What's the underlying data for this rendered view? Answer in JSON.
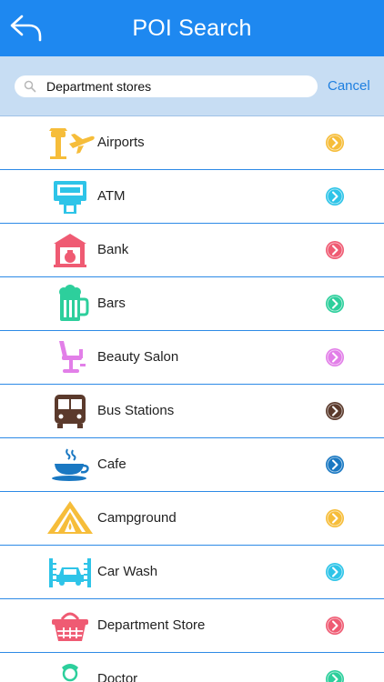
{
  "header": {
    "title": "POI Search"
  },
  "search": {
    "value": "Department stores",
    "cancel_label": "Cancel"
  },
  "items": [
    {
      "label": "Airports",
      "accent": "#f6bd3a",
      "icon": "airport-icon"
    },
    {
      "label": "ATM",
      "accent": "#2ec4e8",
      "icon": "atm-icon"
    },
    {
      "label": "Bank",
      "accent": "#ef5b73",
      "icon": "bank-icon"
    },
    {
      "label": "Bars",
      "accent": "#2dcf9c",
      "icon": "beer-icon"
    },
    {
      "label": "Beauty Salon",
      "accent": "#e27fe8",
      "icon": "salon-chair-icon"
    },
    {
      "label": "Bus Stations",
      "accent": "#5b3a2c",
      "icon": "bus-icon"
    },
    {
      "label": "Cafe",
      "accent": "#1a78c2",
      "icon": "coffee-cup-icon"
    },
    {
      "label": "Campground",
      "accent": "#f6bd3a",
      "icon": "tent-icon"
    },
    {
      "label": "Car Wash",
      "accent": "#2ec4e8",
      "icon": "car-wash-icon"
    },
    {
      "label": "Department Store",
      "accent": "#ef5b73",
      "icon": "basket-icon"
    },
    {
      "label": "Doctor",
      "accent": "#2dcf9c",
      "icon": "doctor-icon"
    }
  ]
}
